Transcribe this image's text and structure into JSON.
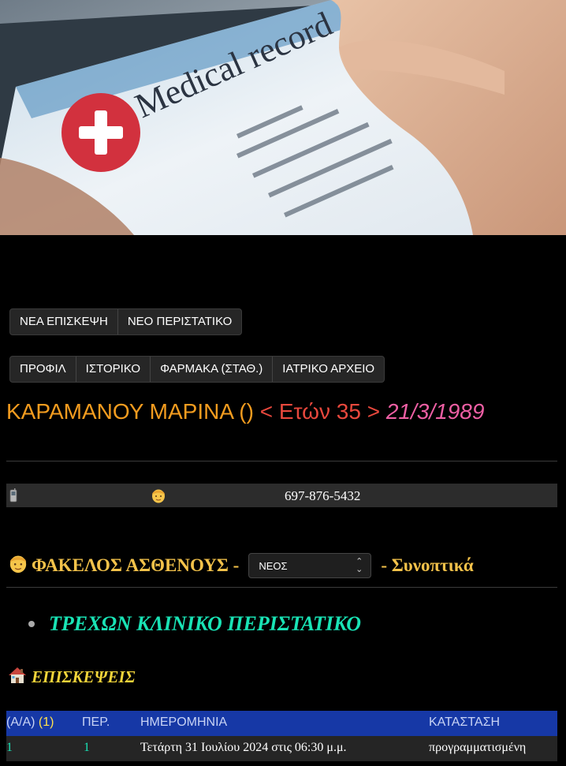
{
  "hero": {
    "image_text": "Medical record"
  },
  "actions": [
    {
      "label": "ΝΕΑ ΕΠΙΣΚΕΨΗ"
    },
    {
      "label": "ΝΕΟ ΠΕΡΙΣΤΑΤΙΚΟ"
    }
  ],
  "nav": [
    {
      "label": "ΠΡΟΦΙΛ"
    },
    {
      "label": "ΙΣΤΟΡΙΚΟ"
    },
    {
      "label": "ΦΑΡΜΑΚΑ (ΣΤΑΘ.)"
    },
    {
      "label": "ΙΑΤΡΙΚΟ ΑΡΧΕΙΟ"
    }
  ],
  "patient": {
    "name": "ΚΑΡΑΜΑΝΟΥ ΜΑΡΙΝΑ ()",
    "age": "< Ετών 35 >",
    "dob": "21/3/1989",
    "phone": "697-876-5432"
  },
  "folder": {
    "title": "ΦΑΚΕΛΟΣ ΑΣΘΕΝΟΥΣ -",
    "select_value": "ΝΕΟΣ",
    "suffix": "- Συνοπτικά"
  },
  "current_case": "ΤΡΕΧΩΝ ΚΛΙΝΙΚΟ ΠΕΡΙΣΤΑΤΙΚΟ",
  "visits": {
    "title": "ΕΠΙΣΚΕΨΕΙΣ",
    "headers": {
      "aa": "(Α/Α)",
      "count": "(1)",
      "per": "ΠΕΡ.",
      "date": "ΗΜΕΡΟΜΗΝΙΑ",
      "status": "ΚΑΤΑΣΤΑΣΗ"
    },
    "rows": [
      {
        "aa": "1",
        "per": "1",
        "date": "Τετάρτη 31 Ιουλίου 2024 στις 06:30 μ.μ.",
        "status": "προγραμματισμένη"
      }
    ]
  },
  "colors": {
    "name": "#f39c1f",
    "age": "#e8483d",
    "dob": "#ee5fa4",
    "folder_title": "#f3c24a",
    "current_case": "#19e3b5",
    "visits_title": "#f2d43a",
    "table_header": "#1638a6"
  },
  "icons": [
    "phone-icon",
    "face-icon",
    "house-icon",
    "chevron-updown-icon"
  ]
}
